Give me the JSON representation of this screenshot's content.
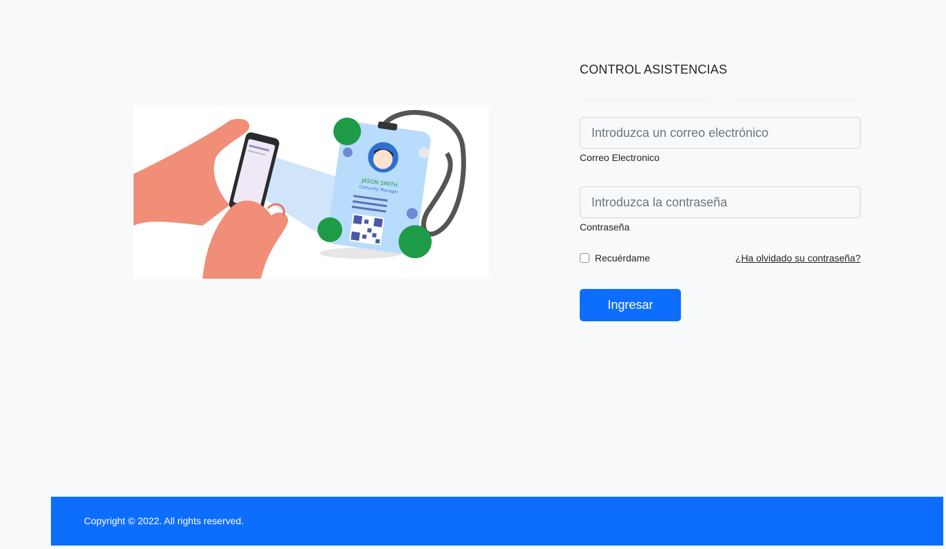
{
  "app": {
    "title": "CONTROL ASISTENCIAS"
  },
  "illustration": {
    "name": "JASON SMITH",
    "role": "Comunity Manager"
  },
  "form": {
    "email": {
      "placeholder": "Introduzca un correo electrónico",
      "label": "Correo Electronico",
      "value": ""
    },
    "password": {
      "placeholder": "Introduzca la contraseña",
      "label": "Contraseña",
      "value": ""
    },
    "remember_label": "Recuérdame",
    "remember_checked": false,
    "forgot_label": "¿Ha olvidado su contraseña?",
    "submit_label": "Ingresar"
  },
  "footer": {
    "copyright": "Copyright © 2022. All rights reserved."
  },
  "colors": {
    "primary": "#0d6efd",
    "background": "#f8f9fa"
  }
}
